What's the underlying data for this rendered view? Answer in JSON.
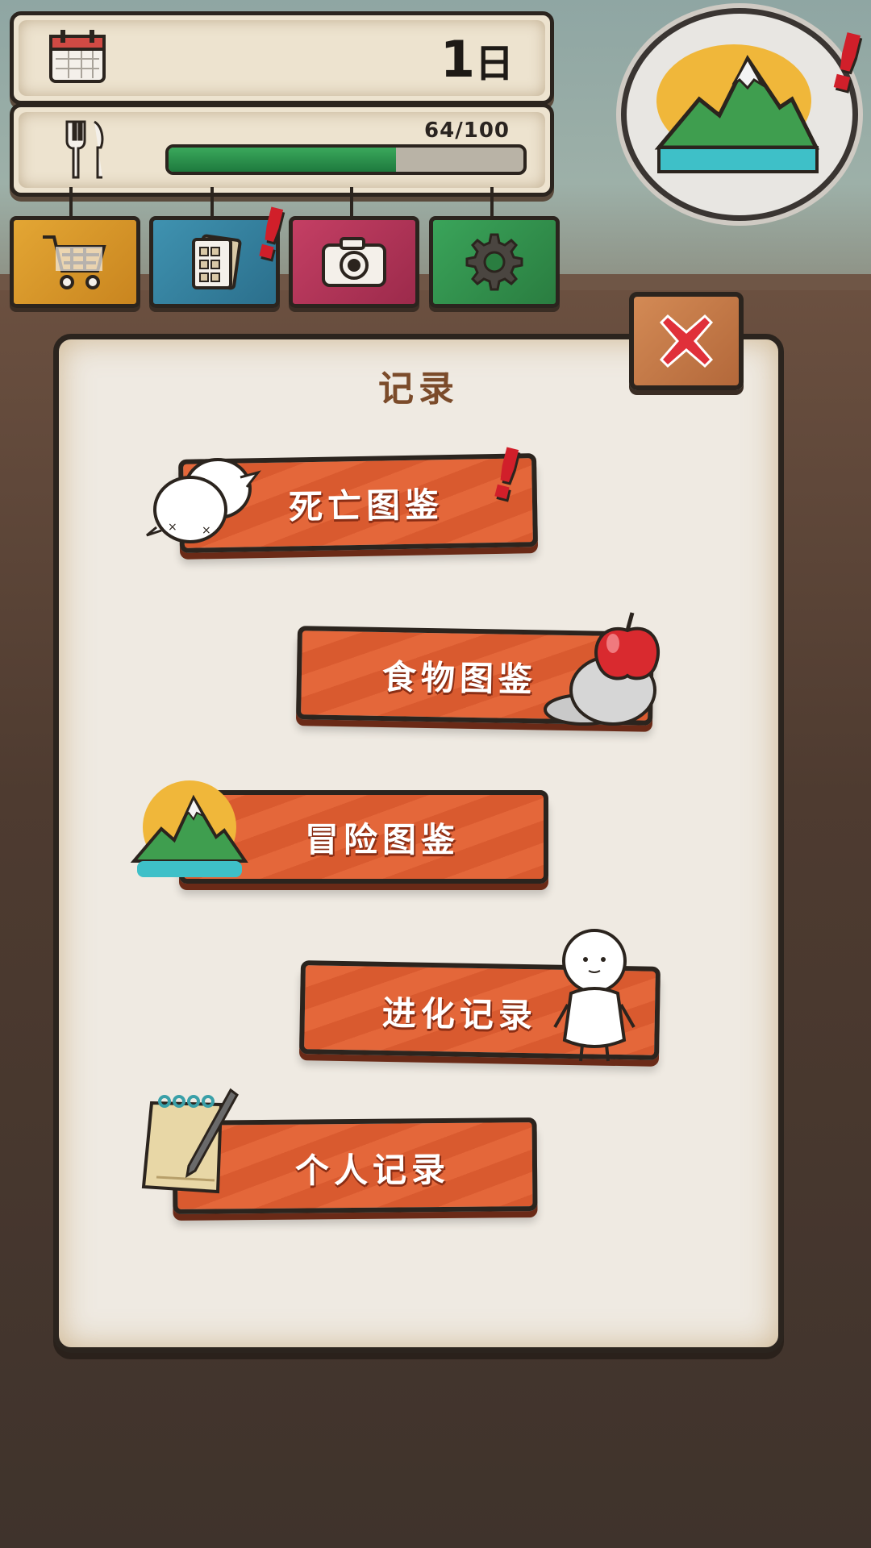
{
  "status": {
    "day_number": "1",
    "day_unit": "日",
    "food_text": "64/100",
    "food_progress": 0.64
  },
  "menu": {
    "icons": [
      "shopping-cart-icon",
      "notebook-icon",
      "camera-icon",
      "gear-icon"
    ]
  },
  "dialog": {
    "title": "记录",
    "buttons": [
      {
        "label": "死亡图鉴",
        "icon": "dead-creature-icon",
        "alert": true
      },
      {
        "label": "食物图鉴",
        "icon": "apple-on-rock-icon"
      },
      {
        "label": "冒险图鉴",
        "icon": "mountain-icon"
      },
      {
        "label": "进化记录",
        "icon": "white-creature-icon"
      },
      {
        "label": "个人记录",
        "icon": "notepad-pen-icon"
      }
    ]
  },
  "colors": {
    "plank": "#e4673a",
    "alert": "#d11f2a",
    "food_bar": "#2a8f4c",
    "title": "#7b4b2a"
  }
}
